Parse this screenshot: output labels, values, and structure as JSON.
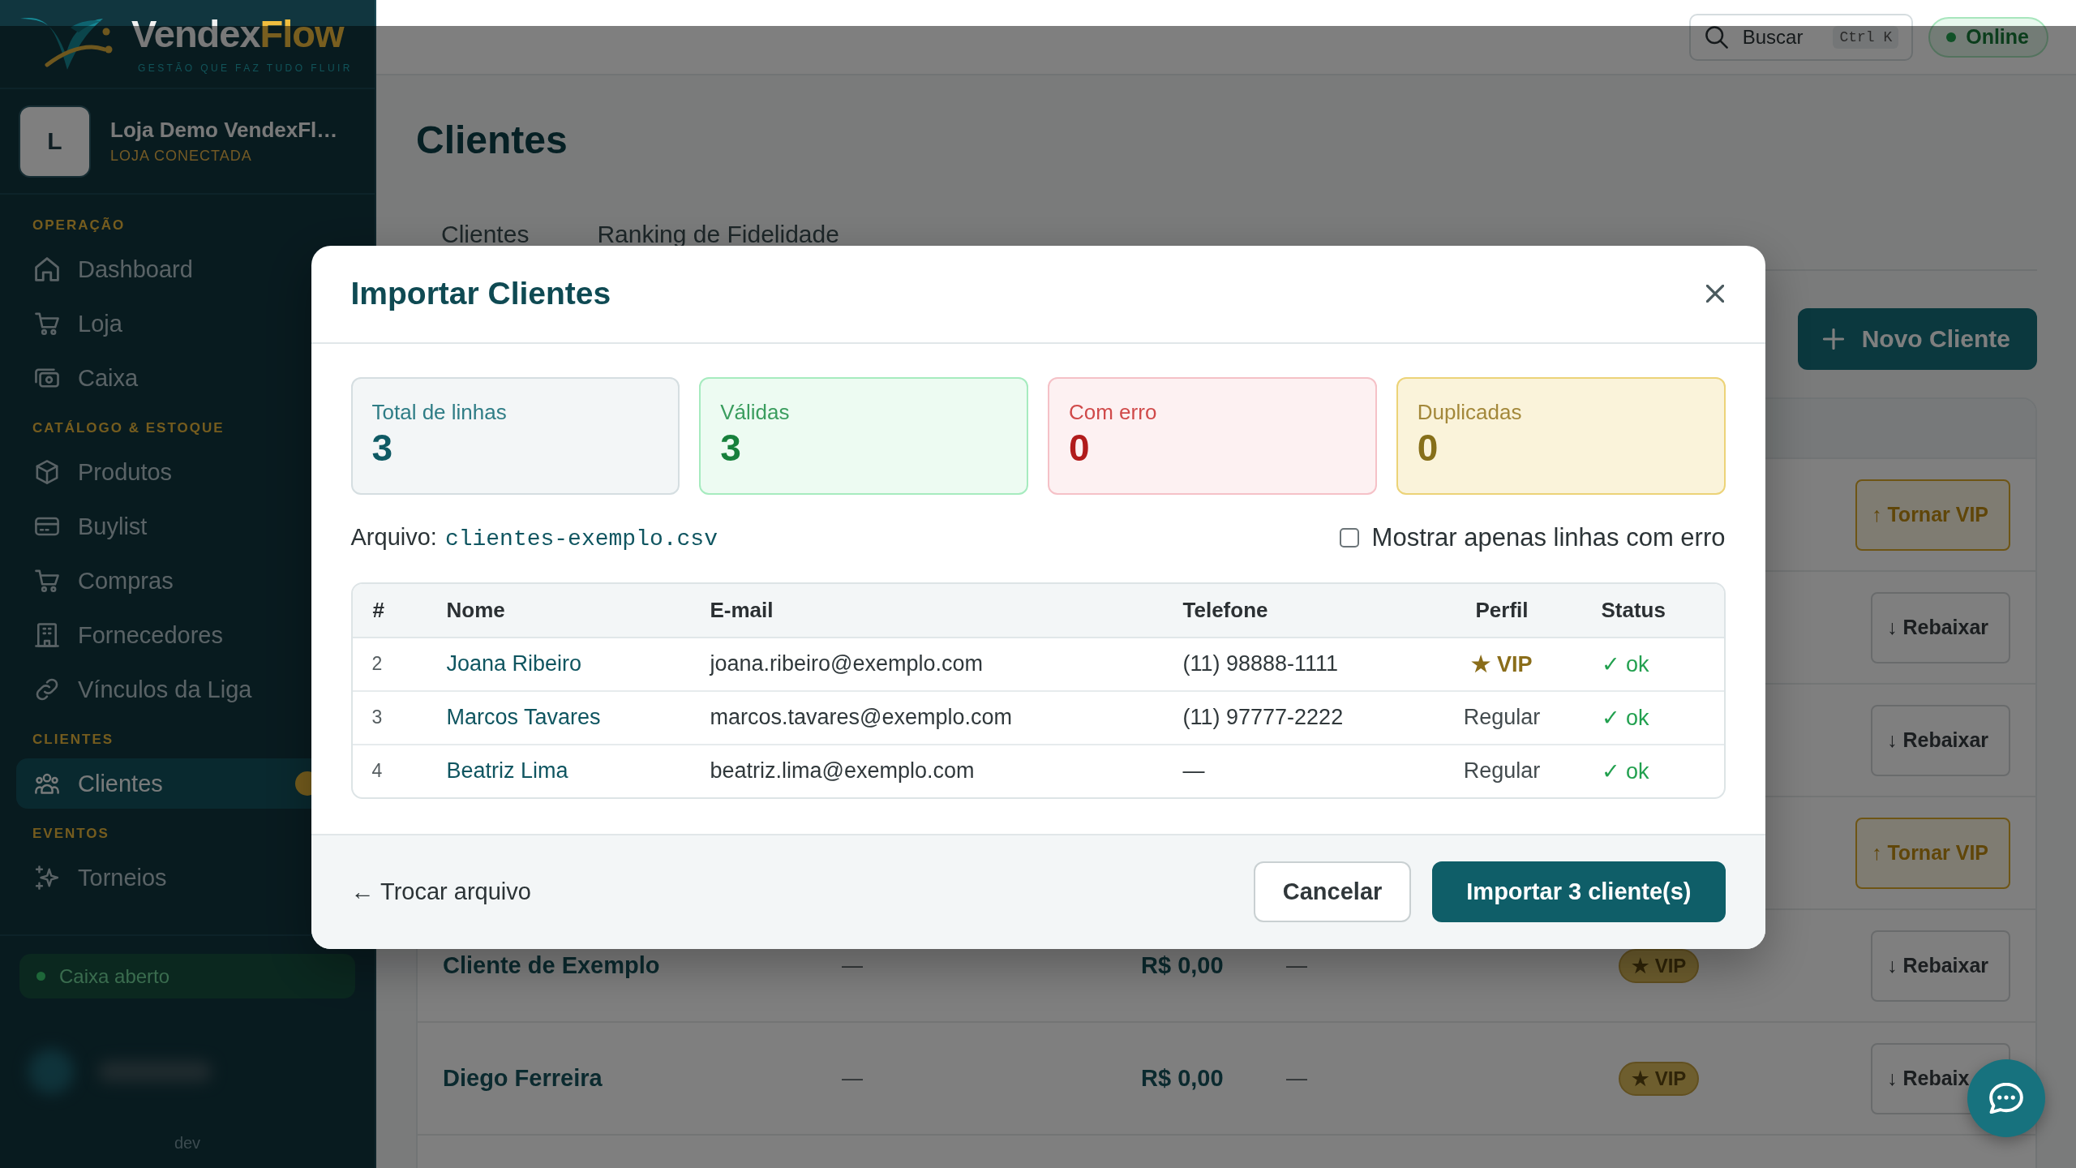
{
  "sidebar": {
    "logo": {
      "wordmark_start": "Vendex",
      "wordmark_end": "Flow",
      "tagline": "GESTÃO QUE FAZ TUDO FLUIR"
    },
    "store": {
      "initial": "L",
      "name": "Loja Demo VendexFl…",
      "status": "LOJA CONECTADA"
    },
    "sections": [
      {
        "title": "OPERAÇÃO",
        "items": [
          {
            "kind": "dashboard",
            "label": "Dashboard",
            "selected": false,
            "badge": false
          },
          {
            "kind": "store",
            "label": "Loja",
            "selected": false,
            "badge": false
          },
          {
            "kind": "register",
            "label": "Caixa",
            "selected": false,
            "badge": false
          }
        ]
      },
      {
        "title": "CATÁLOGO & ESTOQUE",
        "items": [
          {
            "kind": "products",
            "label": "Produtos",
            "selected": false,
            "badge": false
          },
          {
            "kind": "buylist",
            "label": "Buylist",
            "selected": false,
            "badge": false
          },
          {
            "kind": "purchases",
            "label": "Compras",
            "selected": false,
            "badge": false
          },
          {
            "kind": "suppliers",
            "label": "Fornecedores",
            "selected": false,
            "badge": false
          },
          {
            "kind": "links",
            "label": "Vínculos da Liga",
            "selected": false,
            "badge": false
          }
        ]
      },
      {
        "title": "CLIENTES",
        "items": [
          {
            "kind": "customers",
            "label": "Clientes",
            "selected": true,
            "badge": true
          }
        ]
      },
      {
        "title": "EVENTOS",
        "items": [
          {
            "kind": "tournaments",
            "label": "Torneios",
            "selected": false,
            "badge": false
          }
        ]
      }
    ],
    "register": {
      "label": "Caixa aberto",
      "open": true
    },
    "environment": "dev"
  },
  "topbar": {
    "search": {
      "label": "Buscar",
      "shortcut": "Ctrl K"
    },
    "connection": {
      "label": "Online",
      "online": true
    }
  },
  "page": {
    "title": "Clientes",
    "tabs": [
      "Clientes",
      "Ranking de Fidelidade"
    ],
    "primary_action": "Novo Cliente",
    "table": {
      "rows": [
        {
          "action": {
            "kind": "promote",
            "label": "↑ Tornar VIP"
          }
        },
        {
          "action": {
            "kind": "demote",
            "label": "↓ Rebaixar"
          }
        },
        {
          "action": {
            "kind": "demote",
            "label": "↓ Rebaixar"
          }
        },
        {
          "action": {
            "kind": "promote",
            "label": "↑ Tornar VIP"
          }
        },
        {
          "cells": [
            "Cliente de Exemplo",
            "—",
            "R$ 0,00",
            "—"
          ],
          "tag": "★ VIP",
          "action": {
            "kind": "demote",
            "label": "↓ Rebaixar"
          }
        },
        {
          "cells": [
            "Diego Ferreira",
            "—",
            "R$ 0,00",
            "—"
          ],
          "tag": "★ VIP",
          "action": {
            "kind": "demote",
            "label": "↓ Rebaix"
          }
        }
      ]
    }
  },
  "import_dialog": {
    "title": "Importar Clientes",
    "stats": [
      {
        "kind": "total",
        "label": "Total de linhas",
        "value": "3"
      },
      {
        "kind": "valid",
        "label": "Válidas",
        "value": "3"
      },
      {
        "kind": "error",
        "label": "Com erro",
        "value": "0"
      },
      {
        "kind": "duplicate",
        "label": "Duplicadas",
        "value": "0"
      }
    ],
    "file_label": "Arquivo:",
    "file_name": "clientes-exemplo.csv",
    "error_filter": {
      "label": "Mostrar apenas linhas com erro",
      "checked": false
    },
    "table": {
      "columns": [
        "#",
        "Nome",
        "E-mail",
        "Telefone",
        "Perfil",
        "Status"
      ],
      "rows": [
        {
          "line": "2",
          "name": "Joana Ribeiro",
          "email": "joana.ribeiro@exemplo.com",
          "phone": "(11) 98888-1111",
          "profile": {
            "kind": "vip",
            "label": "★ VIP"
          },
          "status": {
            "kind": "ok",
            "label": "✓ ok"
          }
        },
        {
          "line": "3",
          "name": "Marcos Tavares",
          "email": "marcos.tavares@exemplo.com",
          "phone": "(11) 97777-2222",
          "profile": {
            "kind": "regular",
            "label": "Regular"
          },
          "status": {
            "kind": "ok",
            "label": "✓ ok"
          }
        },
        {
          "line": "4",
          "name": "Beatriz Lima",
          "email": "beatriz.lima@exemplo.com",
          "phone": "—",
          "profile": {
            "kind": "regular",
            "label": "Regular"
          },
          "status": {
            "kind": "ok",
            "label": "✓ ok"
          }
        }
      ]
    },
    "back_action": "← Trocar arquivo",
    "cancel_action": "Cancelar",
    "confirm_action": "Importar 3 cliente(s)"
  }
}
